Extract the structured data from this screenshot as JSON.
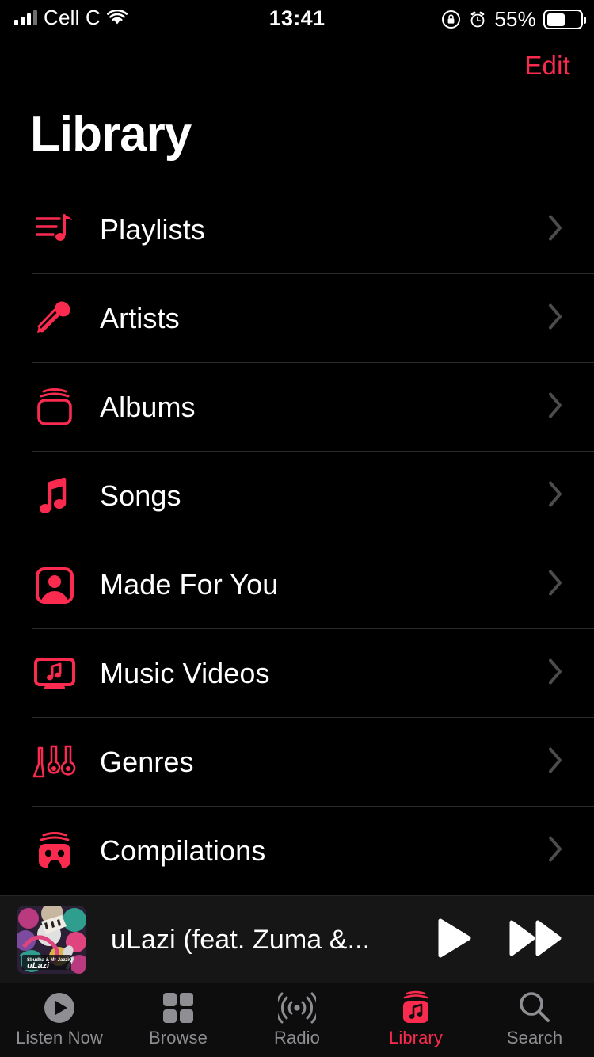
{
  "status_bar": {
    "carrier": "Cell C",
    "signal_icon": "cellular-signal-icon",
    "wifi_icon": "wifi-icon",
    "time": "13:41",
    "rotation_lock_icon": "rotation-lock-icon",
    "alarm_icon": "alarm-clock-icon",
    "battery_percent": "55%",
    "battery_level": 55,
    "battery_icon": "battery-icon"
  },
  "nav": {
    "edit_label": "Edit",
    "accent_color": "#fa2b4e"
  },
  "header": {
    "title": "Library"
  },
  "library": {
    "items": [
      {
        "label": "Playlists",
        "icon": "playlists-icon",
        "chevron": "chevron-right-icon"
      },
      {
        "label": "Artists",
        "icon": "microphone-icon",
        "chevron": "chevron-right-icon"
      },
      {
        "label": "Albums",
        "icon": "albums-icon",
        "chevron": "chevron-right-icon"
      },
      {
        "label": "Songs",
        "icon": "music-note-icon",
        "chevron": "chevron-right-icon"
      },
      {
        "label": "Made For You",
        "icon": "person-frame-icon",
        "chevron": "chevron-right-icon"
      },
      {
        "label": "Music Videos",
        "icon": "music-video-icon",
        "chevron": "chevron-right-icon"
      },
      {
        "label": "Genres",
        "icon": "guitars-icon",
        "chevron": "chevron-right-icon"
      },
      {
        "label": "Compilations",
        "icon": "compilations-icon",
        "chevron": "chevron-right-icon"
      }
    ]
  },
  "now_playing": {
    "artwork_label": "uLazi",
    "track_title": "uLazi (feat. Zuma &...",
    "play_icon": "play-icon",
    "forward_icon": "fast-forward-icon"
  },
  "tab_bar": {
    "active": "Library",
    "tabs": [
      {
        "label": "Listen Now",
        "icon": "play-circle-icon",
        "active": false
      },
      {
        "label": "Browse",
        "icon": "grid-squares-icon",
        "active": false
      },
      {
        "label": "Radio",
        "icon": "broadcast-icon",
        "active": false
      },
      {
        "label": "Library",
        "icon": "library-icon",
        "active": true
      },
      {
        "label": "Search",
        "icon": "search-icon",
        "active": false
      }
    ]
  }
}
